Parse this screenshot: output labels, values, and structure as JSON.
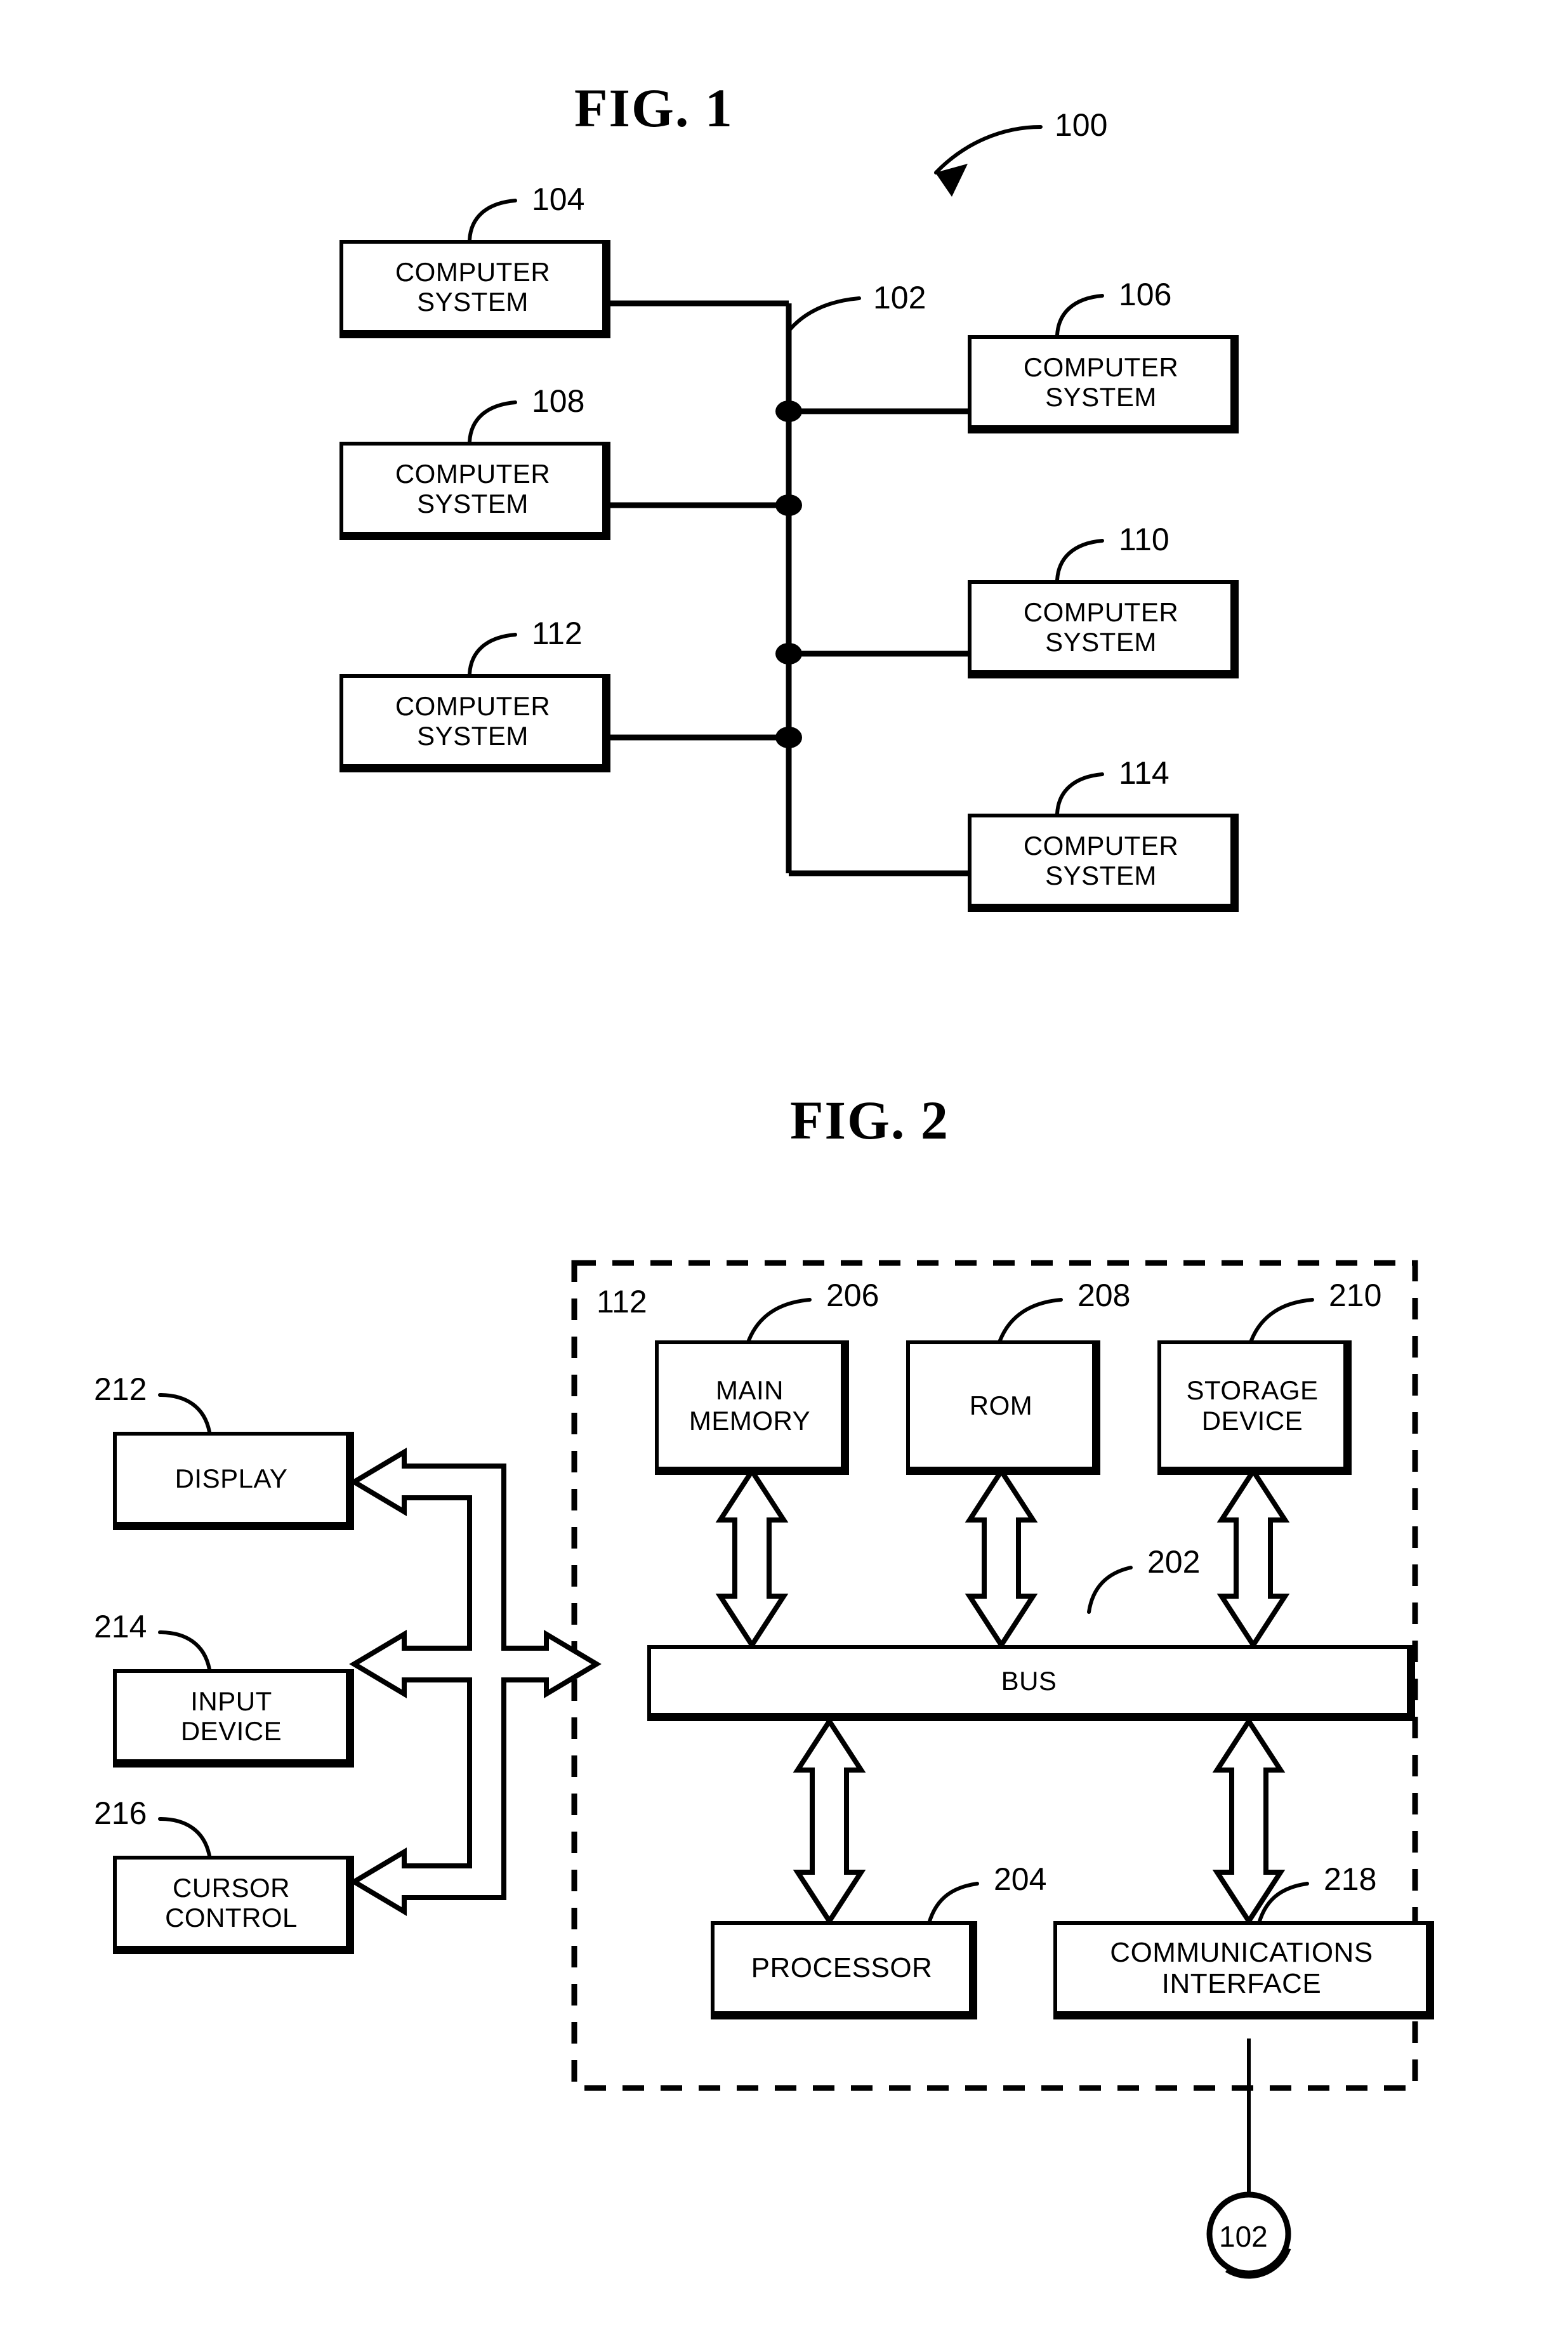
{
  "figures": [
    {
      "title": "FIG. 1",
      "system_ref": "100",
      "network_ref": "102",
      "nodes": [
        {
          "ref": "104",
          "label_line1": "COMPUTER",
          "label_line2": "SYSTEM"
        },
        {
          "ref": "106",
          "label_line1": "COMPUTER",
          "label_line2": "SYSTEM"
        },
        {
          "ref": "108",
          "label_line1": "COMPUTER",
          "label_line2": "SYSTEM"
        },
        {
          "ref": "110",
          "label_line1": "COMPUTER",
          "label_line2": "SYSTEM"
        },
        {
          "ref": "112",
          "label_line1": "COMPUTER",
          "label_line2": "SYSTEM"
        },
        {
          "ref": "114",
          "label_line1": "COMPUTER",
          "label_line2": "SYSTEM"
        }
      ]
    },
    {
      "title": "FIG. 2",
      "enclosure_ref": "112",
      "bus_ref": "202",
      "bus_label": "BUS",
      "network_node_label": "102",
      "components": [
        {
          "ref": "206",
          "label_line1": "MAIN",
          "label_line2": "MEMORY"
        },
        {
          "ref": "208",
          "label_line1": "ROM",
          "label_line2": ""
        },
        {
          "ref": "210",
          "label_line1": "STORAGE",
          "label_line2": "DEVICE"
        },
        {
          "ref": "204",
          "label_line1": "PROCESSOR",
          "label_line2": ""
        },
        {
          "ref": "218",
          "label_line1": "COMMUNICATIONS",
          "label_line2": "INTERFACE"
        }
      ],
      "peripherals": [
        {
          "ref": "212",
          "label_line1": "DISPLAY",
          "label_line2": ""
        },
        {
          "ref": "214",
          "label_line1": "INPUT",
          "label_line2": "DEVICE"
        },
        {
          "ref": "216",
          "label_line1": "CURSOR",
          "label_line2": "CONTROL"
        }
      ]
    }
  ]
}
